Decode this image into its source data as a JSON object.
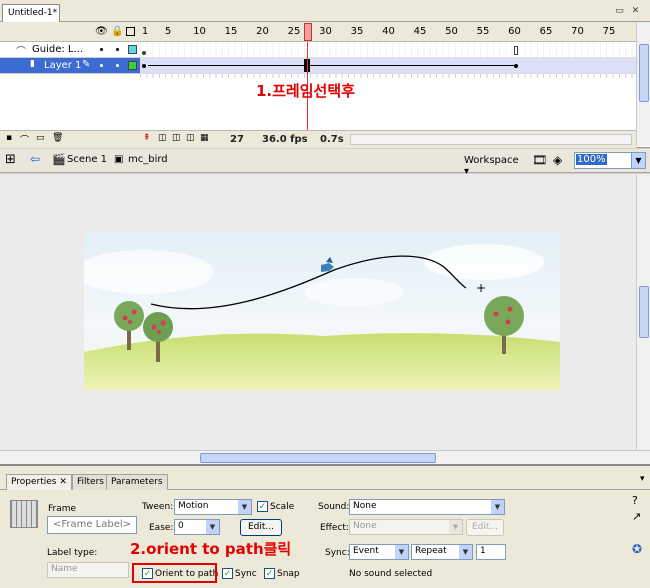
{
  "document": {
    "tab_title": "Untitled-1*"
  },
  "timeline": {
    "ruler": [
      "1",
      "5",
      "10",
      "15",
      "20",
      "25",
      "30",
      "35",
      "40",
      "45",
      "50",
      "55",
      "60",
      "65",
      "70",
      "75"
    ],
    "layers": [
      {
        "name": "Guide: L...",
        "selected": false
      },
      {
        "name": "Layer 1",
        "selected": true
      }
    ],
    "current_frame": "27",
    "fps": "36.0 fps",
    "elapsed": "0.7s",
    "annotation": "1.프레임선택후"
  },
  "editbar": {
    "scene": "Scene 1",
    "symbol": "mc_bird",
    "workspace": "Workspace",
    "zoom": "100%"
  },
  "properties": {
    "tabs": [
      "Properties",
      "Filters",
      "Parameters"
    ],
    "type_label": "Frame",
    "frame_label_placeholder": "<Frame Label>",
    "label_type_label": "Label type:",
    "label_type_value": "Name",
    "tween_label": "Tween:",
    "tween_value": "Motion",
    "scale_label": "Scale",
    "ease_label": "Ease:",
    "ease_value": "0",
    "edit_label": "Edit...",
    "sound_label": "Sound:",
    "sound_value": "None",
    "effect_label": "Effect:",
    "effect_value": "None",
    "effect_edit_label": "Edit...",
    "sync_label": "Sync:",
    "sync_value": "Event",
    "repeat_value": "Repeat",
    "repeat_count": "1",
    "orient_label": "Orient to path",
    "sync_check_label": "Sync",
    "snap_label": "Snap",
    "no_sound": "No sound selected",
    "annotation": "2.orient to path클릭"
  }
}
